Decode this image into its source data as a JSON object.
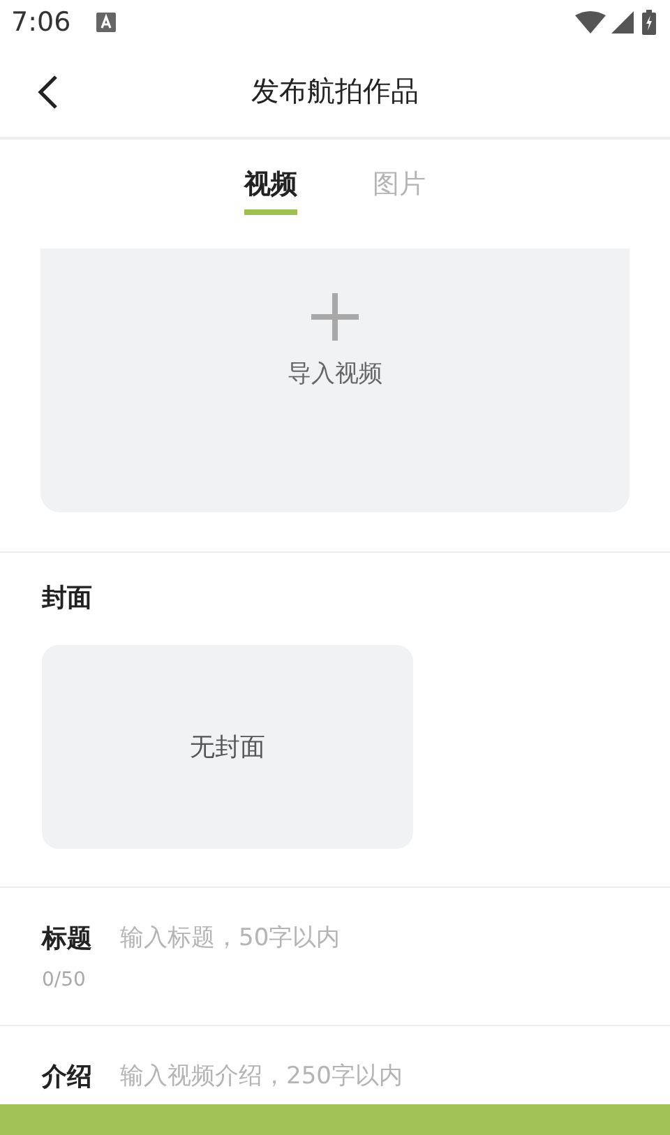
{
  "status_bar": {
    "time": "7:06"
  },
  "header": {
    "title": "发布航拍作品"
  },
  "tabs": [
    {
      "label": "视频",
      "selected": true
    },
    {
      "label": "图片",
      "selected": false
    }
  ],
  "upload": {
    "label": "导入视频"
  },
  "cover": {
    "heading": "封面",
    "placeholder_text": "无封面"
  },
  "title_field": {
    "label": "标题",
    "placeholder": "输入标题，50字以内",
    "counter": "0/50"
  },
  "intro_field": {
    "label": "介绍",
    "placeholder": "输入视频介绍，250字以内"
  }
}
